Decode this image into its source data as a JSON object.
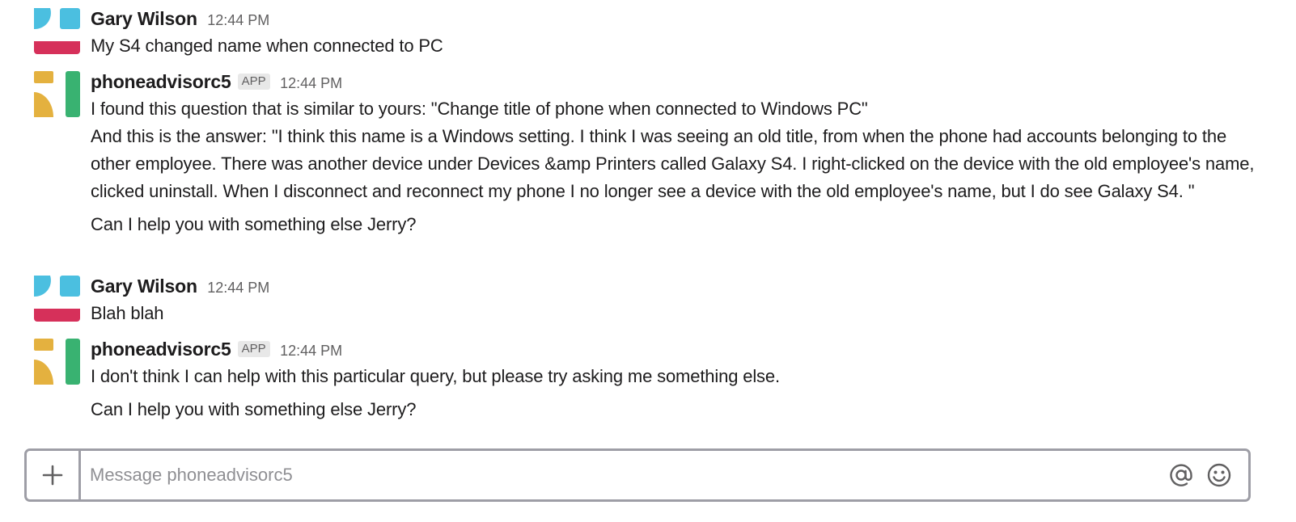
{
  "messages": [
    {
      "author": "Gary Wilson",
      "time": "12:44 PM",
      "lines": [
        "My S4 changed name when connected to PC"
      ]
    },
    {
      "author": "phoneadvisorc5",
      "badge": "APP",
      "time": "12:44 PM",
      "lines": [
        "I found this question that is similar to yours: \"Change title of phone when connected to Windows PC\"",
        "And this is the answer: \"I think this name is a Windows setting. I think I was seeing an old title, from when the phone had accounts belonging to the other employee. There was another device under Devices &amp Printers called Galaxy S4. I right-clicked on the device with the old employee's name, clicked uninstall. When I disconnect and reconnect my phone I no longer see a device with the old employee's name, but I do see Galaxy S4. \"",
        "Can I help you with something else Jerry?"
      ]
    },
    {
      "author": "Gary Wilson",
      "time": "12:44 PM",
      "lines": [
        "Blah blah"
      ]
    },
    {
      "author": "phoneadvisorc5",
      "badge": "APP",
      "time": "12:44 PM",
      "lines": [
        "I don't think I can help with this particular query, but please try asking me something else.",
        "Can I help you with something else Jerry?"
      ]
    }
  ],
  "composer": {
    "placeholder": "Message phoneadvisorc5",
    "value": "",
    "plus_icon": "plus-icon",
    "mention_icon": "at-sign-icon",
    "emoji_icon": "smiley-face-icon"
  },
  "colors": {
    "user_avatar_blue": "#4bbfe0",
    "user_avatar_red": "#d6305a",
    "app_avatar_yellow": "#e4b13f",
    "app_avatar_green": "#39b271",
    "composer_border": "#9e9ea6"
  }
}
